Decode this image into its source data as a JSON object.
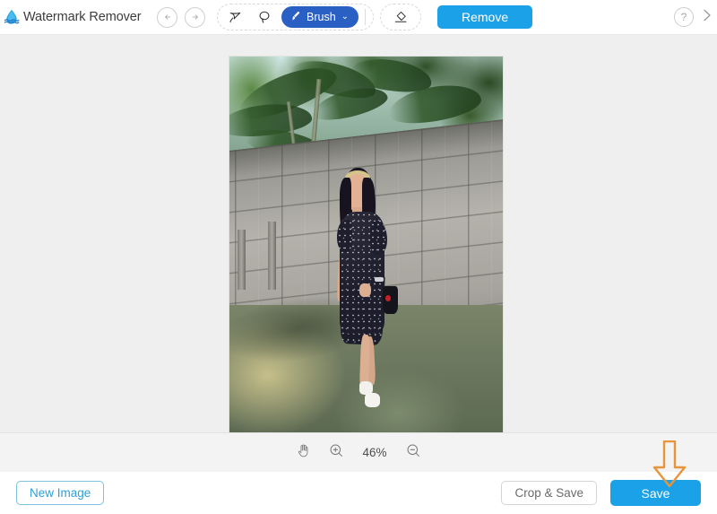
{
  "app": {
    "title": "Watermark Remover",
    "logo_icon": "water-drop-logo",
    "accent_blue": "#1ba1e8",
    "brush_blue": "#2a5fc4",
    "outline_blue": "#2f9fd4",
    "annotation_orange": "#e8943a",
    "canvas_bg": "#efefef",
    "zoombar_bg": "#f3f3f3"
  },
  "header": {
    "undo": {
      "label": "Undo",
      "icon": "undo-arrow-icon",
      "disabled": true
    },
    "redo": {
      "label": "Redo",
      "icon": "redo-arrow-icon",
      "disabled": true
    },
    "tools": [
      {
        "id": "marker",
        "label": "Marker",
        "icon": "marker-scribble-icon",
        "active": false
      },
      {
        "id": "lasso",
        "label": "Lasso",
        "icon": "lasso-icon",
        "active": false
      },
      {
        "id": "brush",
        "label": "Brush",
        "icon": "brush-icon",
        "active": true,
        "caret": "⌄"
      }
    ],
    "eraser": {
      "label": "Eraser",
      "icon": "eraser-icon"
    },
    "remove_button": "Remove",
    "help": {
      "label": "Help",
      "icon": "question-mark-icon"
    },
    "collapse": {
      "label": "Next",
      "icon": "chevron-right-icon"
    }
  },
  "canvas": {
    "image_alt": "Woman in a dark floral dress standing beside a concrete block wall with palm trees"
  },
  "zoombar": {
    "hand_tool": {
      "label": "Pan",
      "icon": "hand-icon"
    },
    "zoom_in": {
      "label": "Zoom in",
      "icon": "zoom-in-icon"
    },
    "zoom_level": "46%",
    "zoom_out": {
      "label": "Zoom out",
      "icon": "zoom-out-icon"
    }
  },
  "footer": {
    "new_image": "New Image",
    "crop_and_save": "Crop & Save",
    "save": "Save"
  },
  "annotation": {
    "arrow": {
      "name": "down-arrow-annotation",
      "points_to": "Save",
      "color": "#e8943a"
    }
  }
}
